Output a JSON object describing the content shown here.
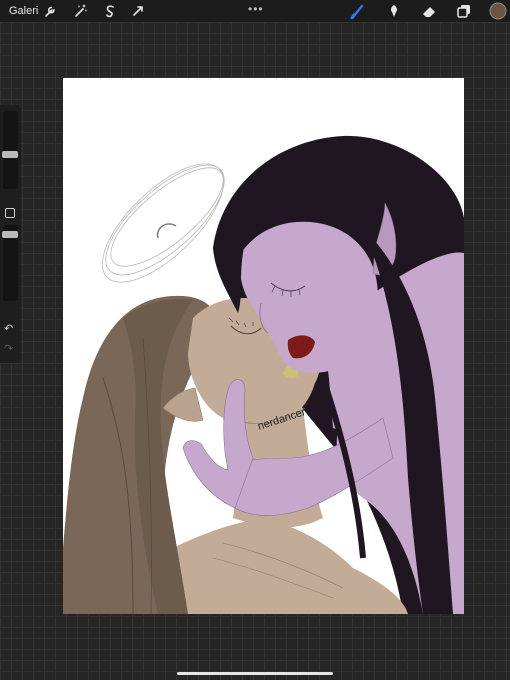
{
  "toolbar": {
    "gallery_label": "Galeri",
    "more_label": "•••",
    "left_tools": [
      "wrench-icon",
      "magic-wand-icon",
      "selection-icon",
      "transform-icon"
    ],
    "right_tools": [
      "brush-icon",
      "smudge-icon",
      "eraser-icon",
      "layers-icon"
    ],
    "active_tool": "brush-icon",
    "accent_color": "#2f7cf6",
    "current_color": "#6b5346"
  },
  "sidebar": {
    "undo_glyph": "↶",
    "redo_glyph": "↷"
  },
  "artwork": {
    "signature": "nerdancer"
  },
  "colors": {
    "background": "#262626",
    "canvas": "#ffffff",
    "skin_purple": "#c5a8cc",
    "skin_tan": "#c2ab97",
    "hair_dark": "#1f1621",
    "hair_brown": "#7a6758",
    "lips": "#7d1a1a"
  }
}
